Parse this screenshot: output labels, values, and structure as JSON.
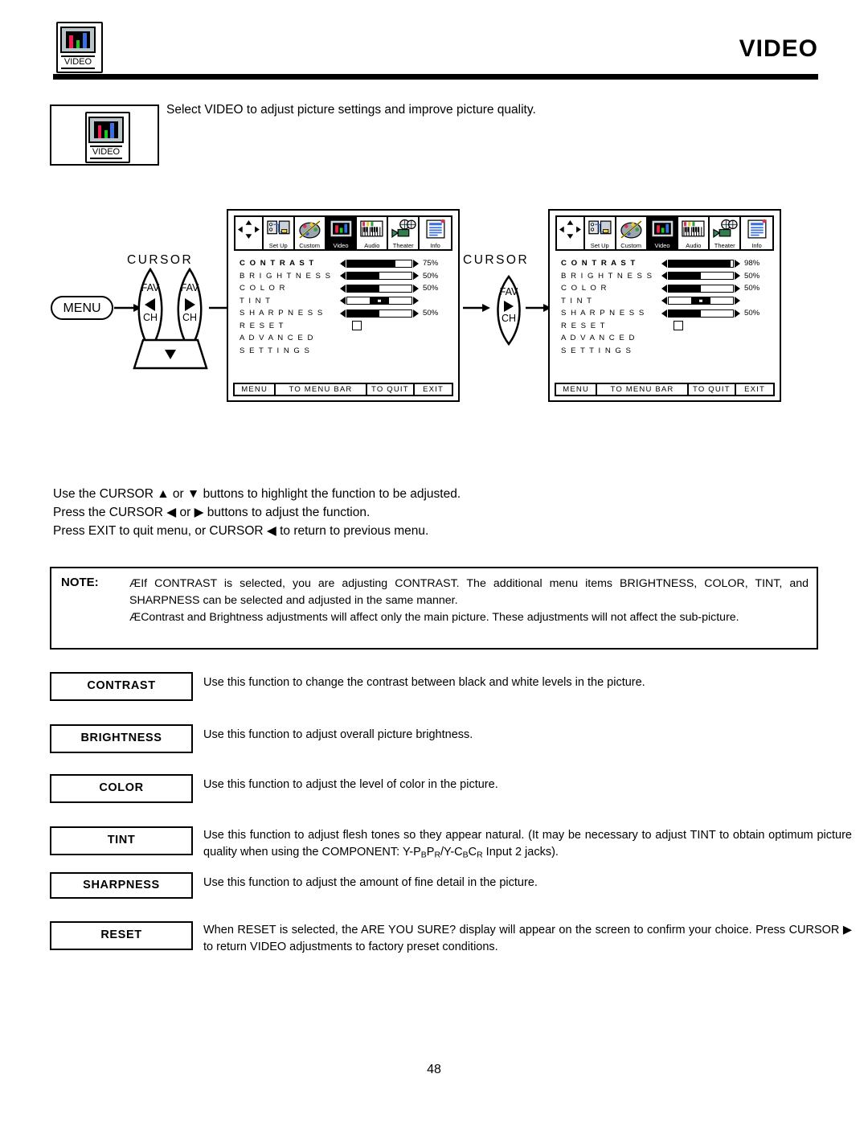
{
  "header": {
    "title": "VIDEO",
    "icon_name": "video-icon",
    "icon_label": "VIDEO"
  },
  "intro": {
    "icon_label": "VIDEO",
    "text": "Select VIDEO to adjust picture settings and improve picture quality."
  },
  "flow": {
    "cursor_label_left": "CURSOR",
    "cursor_label_middle": "CURSOR",
    "menu_button": "MENU",
    "fav_label": "FAV",
    "ch_label": "CH"
  },
  "osd": {
    "tabs": [
      {
        "name": "cursor-pad",
        "label": ""
      },
      {
        "name": "set-up",
        "label": "Set Up"
      },
      {
        "name": "custom",
        "label": "Custom"
      },
      {
        "name": "video",
        "label": "Video"
      },
      {
        "name": "audio",
        "label": "Audio"
      },
      {
        "name": "theater",
        "label": "Theater"
      },
      {
        "name": "info",
        "label": "Info"
      }
    ],
    "selected_tab": "Video",
    "footer": [
      "MENU",
      "TO MENU BAR",
      "TO QUIT",
      "EXIT"
    ],
    "panel_a": {
      "rows": [
        {
          "label": "C O N T R A S T",
          "value": "75%",
          "fill": 75,
          "type": "bar",
          "selected": true
        },
        {
          "label": "B R I G H T N E S S",
          "value": "50%",
          "fill": 50,
          "type": "bar",
          "selected": false
        },
        {
          "label": "C O L O R",
          "value": "50%",
          "fill": 50,
          "type": "bar",
          "selected": false
        },
        {
          "label": "T I N T",
          "value": "",
          "fill": 50,
          "type": "center",
          "selected": false
        },
        {
          "label": "S H A R P N E S S",
          "value": "50%",
          "fill": 50,
          "type": "bar",
          "selected": false
        },
        {
          "label": "R E S E T",
          "value": "",
          "fill": 0,
          "type": "check",
          "selected": false
        },
        {
          "label": "A D V A N C E D",
          "value": "",
          "fill": 0,
          "type": "none",
          "selected": false
        },
        {
          "label": "    S E T T I N G S",
          "value": "",
          "fill": 0,
          "type": "none",
          "selected": false
        }
      ]
    },
    "panel_b": {
      "rows": [
        {
          "label": "C O N T R A S T",
          "value": "98%",
          "fill": 96,
          "type": "bar",
          "selected": true
        },
        {
          "label": "B R I G H T N E S S",
          "value": "50%",
          "fill": 50,
          "type": "bar",
          "selected": false
        },
        {
          "label": "C O L O R",
          "value": "50%",
          "fill": 50,
          "type": "bar",
          "selected": false
        },
        {
          "label": "T I N T",
          "value": "",
          "fill": 50,
          "type": "center",
          "selected": false
        },
        {
          "label": "S H A R P N E S S",
          "value": "50%",
          "fill": 50,
          "type": "bar",
          "selected": false
        },
        {
          "label": "R E S E T",
          "value": "",
          "fill": 0,
          "type": "check",
          "selected": false
        },
        {
          "label": "A D V A N C E D",
          "value": "",
          "fill": 0,
          "type": "none",
          "selected": false
        },
        {
          "label": "    S E T T I N G S",
          "value": "",
          "fill": 0,
          "type": "none",
          "selected": false
        }
      ]
    }
  },
  "usage": {
    "line1": "Use the CURSOR ▲ or ▼ buttons to highlight the function to be adjusted.",
    "line2": "Press the CURSOR ◀ or ▶ buttons to adjust the function.",
    "line3": "Press EXIT to quit menu, or CURSOR ◀ to return to previous menu."
  },
  "note": {
    "label": "NOTE:",
    "item1": "ÆIf CONTRAST is selected, you are adjusting CONTRAST.  The additional menu items BRIGHTNESS, COLOR, TINT, and SHARPNESS can be selected and adjusted in the same manner.",
    "item2": "ÆContrast and Brightness adjustments will affect only the main picture. These adjustments will not affect the sub-picture."
  },
  "functions": [
    {
      "name": "CONTRAST",
      "desc": "Use this function to change the contrast between black and white levels in the picture."
    },
    {
      "name": "BRIGHTNESS",
      "desc": "Use this function to adjust overall picture brightness."
    },
    {
      "name": "COLOR",
      "desc": "Use this function to adjust the level of color in the picture."
    },
    {
      "name": "TINT",
      "desc": "Use this function to adjust flesh tones so they appear natural. (It may be necessary to adjust TINT to obtain optimum picture quality when using the COMPONENT: Y-PBPR/Y-CBCR Input 2 jacks)."
    },
    {
      "name": "SHARPNESS",
      "desc": "Use this function to adjust the amount of fine detail in the picture."
    },
    {
      "name": "RESET",
      "desc": "When RESET is selected, the  ARE YOU SURE?  display will appear on the screen to confirm your choice. Press CURSOR ▶ to return VIDEO adjustments to factory preset conditions."
    }
  ],
  "page_number": "48",
  "colors": {
    "red_bar": "#ef1f52",
    "green_bar": "#1ec81e",
    "blue_bar": "#3a6fe0",
    "screen_gray": "#b9c4c9",
    "ink": "#000000"
  }
}
